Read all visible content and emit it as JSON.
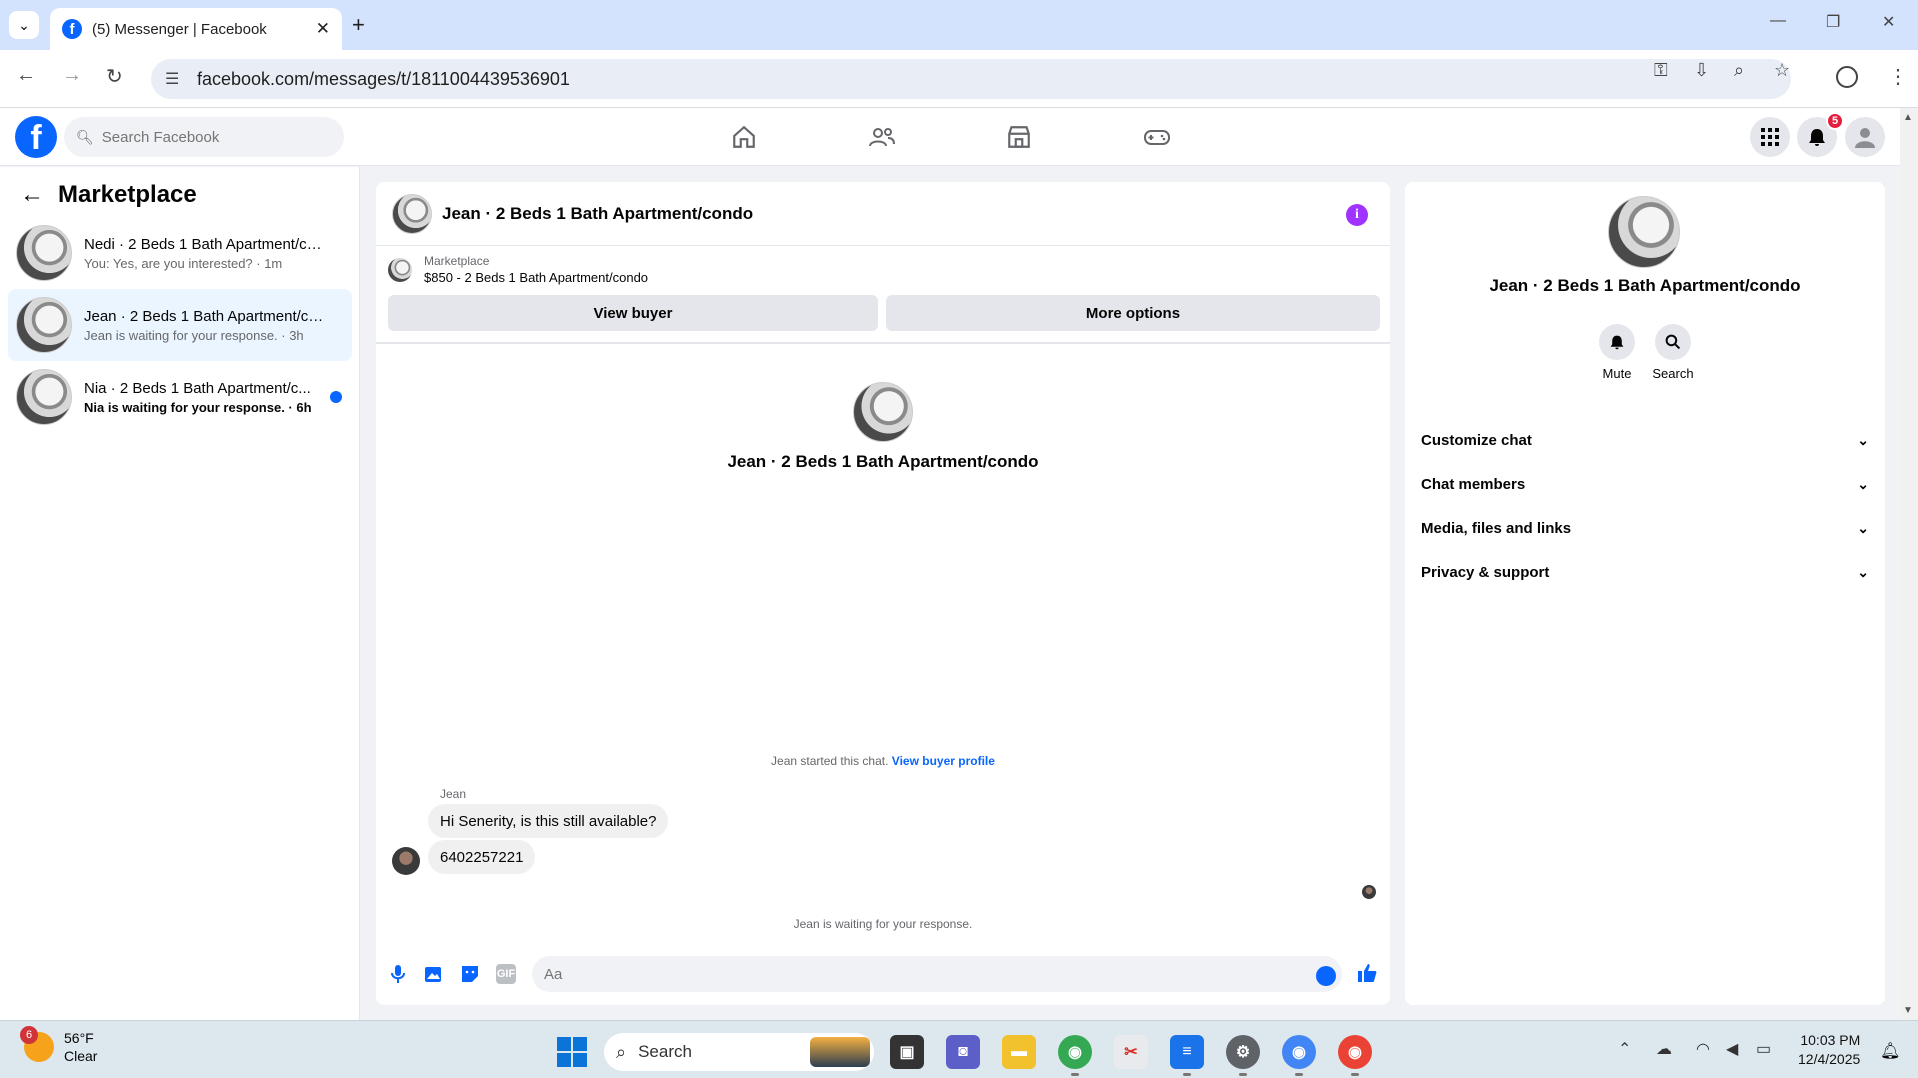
{
  "browser": {
    "tab_title": "(5) Messenger | Facebook",
    "tab_favicon": "f",
    "url": "facebook.com/messages/t/1811004439536901"
  },
  "fb": {
    "logo": "f",
    "search_placeholder": "Search Facebook",
    "notification_count": "5",
    "nav_icons": [
      "home-icon",
      "friends-icon",
      "marketplace-icon",
      "gaming-icon"
    ]
  },
  "sidebar": {
    "title": "Marketplace",
    "conversations": [
      {
        "name": "Nedi · 2 Beds 1 Bath Apartment/co...",
        "sub": "You: Yes, are you interested? · 1m",
        "unread": false
      },
      {
        "name": "Jean · 2 Beds 1 Bath Apartment/co...",
        "sub": "Jean is waiting for your response. · 3h",
        "unread": false
      },
      {
        "name": "Nia · 2 Beds 1 Bath Apartment/c...",
        "sub": "Nia is waiting for your response. · 6h",
        "unread": true
      }
    ]
  },
  "chat": {
    "header_name": "Jean · 2 Beds 1 Bath Apartment/condo",
    "marketplace_label": "Marketplace",
    "listing": "$850 - 2 Beds 1 Bath Apartment/condo",
    "view_buyer": "View buyer",
    "more_options": "More options",
    "profile_name": "Jean · 2 Beds 1 Bath Apartment/condo",
    "started_text": "Jean started this chat.",
    "view_buyer_profile": "View buyer profile",
    "sender": "Jean",
    "messages": [
      "Hi Senerity, is this still available?",
      "6402257221"
    ],
    "waiting": "Jean is waiting for your response.",
    "input_placeholder": "Aa"
  },
  "details": {
    "name": "Jean · 2 Beds 1 Bath Apartment/condo",
    "actions": [
      "Mute",
      "Search"
    ],
    "sections": [
      "Customize chat",
      "Chat members",
      "Media, files and links",
      "Privacy & support"
    ]
  },
  "taskbar": {
    "weather_badge": "6",
    "temp": "56°F",
    "condition": "Clear",
    "search": "Search",
    "time": "10:03 PM",
    "date": "12/4/2025"
  }
}
